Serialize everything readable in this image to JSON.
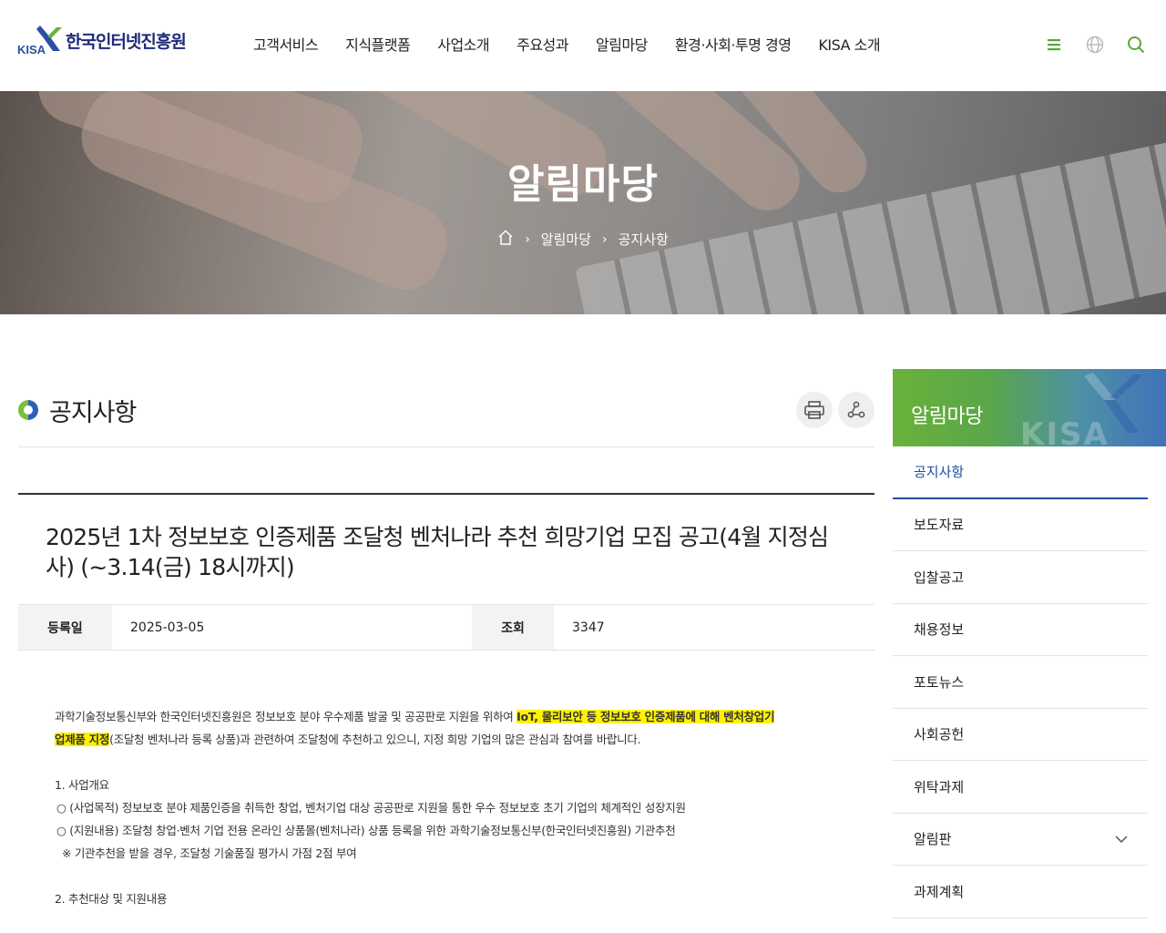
{
  "header": {
    "logo_small": "KISA",
    "logo_text": "한국인터넷진흥원",
    "nav": [
      "고객서비스",
      "지식플랫폼",
      "사업소개",
      "주요성과",
      "알림마당",
      "환경·사회·투명 경영",
      "KISA 소개"
    ],
    "icons": [
      "menu-icon",
      "globe-icon",
      "search-icon"
    ],
    "accent_color": "#6ab23b"
  },
  "hero": {
    "title": "알림마당",
    "breadcrumb": [
      "알림마당",
      "공지사항"
    ]
  },
  "page": {
    "title": "공지사항",
    "tools": [
      "print-icon",
      "share-icon"
    ]
  },
  "post": {
    "title": "2025년 1차 정보보호 인증제품 조달청 벤처나라 추천 희망기업 모집 공고(4월 지정심사) (~3.14(금) 18시까지)",
    "date_label": "등록일",
    "date": "2025-03-05",
    "views_label": "조회",
    "views": "3347",
    "body": {
      "intro_pre": "과학기술정보통신부와 한국인터넷진흥원은 정보보호 분야 우수제품 발굴 및 공공판로 지원을 위하여 ",
      "intro_hl1": "IoT, 물리보안 등 정보보호 인증제품에 대해 벤처창업기",
      "intro_hl2": "업제품 지정",
      "intro_post": "(조달청 벤처나라 등록 상품)과 관련하여 조달청에 추천하고 있으니, 지정 희망 기업의 많은 관심과 참여를 바랍니다.",
      "s1_title": "1. 사업개요",
      "s1_l1": "○ (사업목적) 정보보호 분야 제품인증을 취득한 창업, 벤처기업 대상 공공판로 지원을 통한 우수 정보보호 초기 기업의 체계적인 성장지원",
      "s1_l2": "○ (지원내용) 조달청 창업·벤처 기업 전용 온라인 상품몰(벤처나라) 상품 등록을 위한 과학기술정보통신부(한국인터넷진흥원) 기관추천",
      "s1_l3": "※ 기관추천을 받을 경우, 조달청 기술품질 평가시 가점 2점 부여",
      "s2_title": "2. 추천대상 및 지원내용"
    }
  },
  "side": {
    "title": "알림마당",
    "watermark": "KISA",
    "items": [
      "공지사항",
      "보도자료",
      "입찰공고",
      "채용정보",
      "포토뉴스",
      "사회공헌",
      "위탁과제",
      "알림판",
      "과제계획"
    ]
  }
}
